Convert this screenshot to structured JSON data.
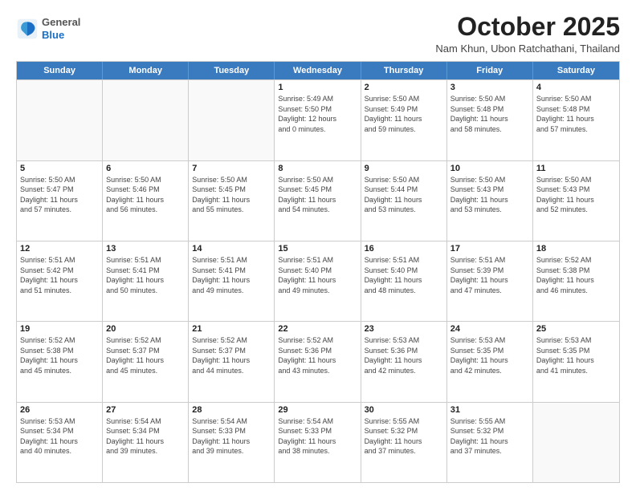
{
  "logo": {
    "general": "General",
    "blue": "Blue"
  },
  "header": {
    "month": "October 2025",
    "location": "Nam Khun, Ubon Ratchathani, Thailand"
  },
  "weekdays": [
    "Sunday",
    "Monday",
    "Tuesday",
    "Wednesday",
    "Thursday",
    "Friday",
    "Saturday"
  ],
  "rows": [
    [
      {
        "day": "",
        "info": ""
      },
      {
        "day": "",
        "info": ""
      },
      {
        "day": "",
        "info": ""
      },
      {
        "day": "1",
        "info": "Sunrise: 5:49 AM\nSunset: 5:50 PM\nDaylight: 12 hours\nand 0 minutes."
      },
      {
        "day": "2",
        "info": "Sunrise: 5:50 AM\nSunset: 5:49 PM\nDaylight: 11 hours\nand 59 minutes."
      },
      {
        "day": "3",
        "info": "Sunrise: 5:50 AM\nSunset: 5:48 PM\nDaylight: 11 hours\nand 58 minutes."
      },
      {
        "day": "4",
        "info": "Sunrise: 5:50 AM\nSunset: 5:48 PM\nDaylight: 11 hours\nand 57 minutes."
      }
    ],
    [
      {
        "day": "5",
        "info": "Sunrise: 5:50 AM\nSunset: 5:47 PM\nDaylight: 11 hours\nand 57 minutes."
      },
      {
        "day": "6",
        "info": "Sunrise: 5:50 AM\nSunset: 5:46 PM\nDaylight: 11 hours\nand 56 minutes."
      },
      {
        "day": "7",
        "info": "Sunrise: 5:50 AM\nSunset: 5:45 PM\nDaylight: 11 hours\nand 55 minutes."
      },
      {
        "day": "8",
        "info": "Sunrise: 5:50 AM\nSunset: 5:45 PM\nDaylight: 11 hours\nand 54 minutes."
      },
      {
        "day": "9",
        "info": "Sunrise: 5:50 AM\nSunset: 5:44 PM\nDaylight: 11 hours\nand 53 minutes."
      },
      {
        "day": "10",
        "info": "Sunrise: 5:50 AM\nSunset: 5:43 PM\nDaylight: 11 hours\nand 53 minutes."
      },
      {
        "day": "11",
        "info": "Sunrise: 5:50 AM\nSunset: 5:43 PM\nDaylight: 11 hours\nand 52 minutes."
      }
    ],
    [
      {
        "day": "12",
        "info": "Sunrise: 5:51 AM\nSunset: 5:42 PM\nDaylight: 11 hours\nand 51 minutes."
      },
      {
        "day": "13",
        "info": "Sunrise: 5:51 AM\nSunset: 5:41 PM\nDaylight: 11 hours\nand 50 minutes."
      },
      {
        "day": "14",
        "info": "Sunrise: 5:51 AM\nSunset: 5:41 PM\nDaylight: 11 hours\nand 49 minutes."
      },
      {
        "day": "15",
        "info": "Sunrise: 5:51 AM\nSunset: 5:40 PM\nDaylight: 11 hours\nand 49 minutes."
      },
      {
        "day": "16",
        "info": "Sunrise: 5:51 AM\nSunset: 5:40 PM\nDaylight: 11 hours\nand 48 minutes."
      },
      {
        "day": "17",
        "info": "Sunrise: 5:51 AM\nSunset: 5:39 PM\nDaylight: 11 hours\nand 47 minutes."
      },
      {
        "day": "18",
        "info": "Sunrise: 5:52 AM\nSunset: 5:38 PM\nDaylight: 11 hours\nand 46 minutes."
      }
    ],
    [
      {
        "day": "19",
        "info": "Sunrise: 5:52 AM\nSunset: 5:38 PM\nDaylight: 11 hours\nand 45 minutes."
      },
      {
        "day": "20",
        "info": "Sunrise: 5:52 AM\nSunset: 5:37 PM\nDaylight: 11 hours\nand 45 minutes."
      },
      {
        "day": "21",
        "info": "Sunrise: 5:52 AM\nSunset: 5:37 PM\nDaylight: 11 hours\nand 44 minutes."
      },
      {
        "day": "22",
        "info": "Sunrise: 5:52 AM\nSunset: 5:36 PM\nDaylight: 11 hours\nand 43 minutes."
      },
      {
        "day": "23",
        "info": "Sunrise: 5:53 AM\nSunset: 5:36 PM\nDaylight: 11 hours\nand 42 minutes."
      },
      {
        "day": "24",
        "info": "Sunrise: 5:53 AM\nSunset: 5:35 PM\nDaylight: 11 hours\nand 42 minutes."
      },
      {
        "day": "25",
        "info": "Sunrise: 5:53 AM\nSunset: 5:35 PM\nDaylight: 11 hours\nand 41 minutes."
      }
    ],
    [
      {
        "day": "26",
        "info": "Sunrise: 5:53 AM\nSunset: 5:34 PM\nDaylight: 11 hours\nand 40 minutes."
      },
      {
        "day": "27",
        "info": "Sunrise: 5:54 AM\nSunset: 5:34 PM\nDaylight: 11 hours\nand 39 minutes."
      },
      {
        "day": "28",
        "info": "Sunrise: 5:54 AM\nSunset: 5:33 PM\nDaylight: 11 hours\nand 39 minutes."
      },
      {
        "day": "29",
        "info": "Sunrise: 5:54 AM\nSunset: 5:33 PM\nDaylight: 11 hours\nand 38 minutes."
      },
      {
        "day": "30",
        "info": "Sunrise: 5:55 AM\nSunset: 5:32 PM\nDaylight: 11 hours\nand 37 minutes."
      },
      {
        "day": "31",
        "info": "Sunrise: 5:55 AM\nSunset: 5:32 PM\nDaylight: 11 hours\nand 37 minutes."
      },
      {
        "day": "",
        "info": ""
      }
    ]
  ]
}
